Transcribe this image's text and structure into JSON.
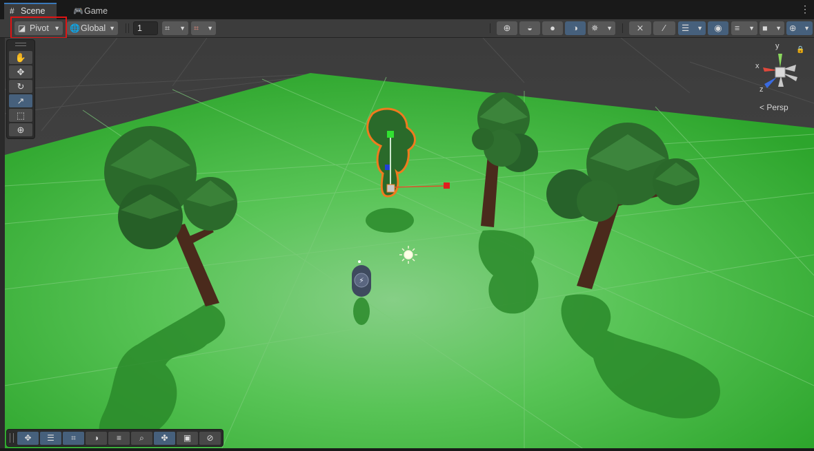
{
  "tabs": [
    {
      "label": "Scene",
      "icon": "grid-icon",
      "active": true
    },
    {
      "label": "Game",
      "icon": "gamepad-icon",
      "active": false
    }
  ],
  "toolbar": {
    "pivot_label": "Pivot",
    "global_label": "Global",
    "grid_value": "1"
  },
  "gizmo": {
    "x_label": "x",
    "y_label": "y",
    "z_label": "z",
    "persp_label": "< Persp"
  },
  "colors": {
    "accent": "#46607c",
    "highlight": "#e01414",
    "ground": "#4cc04c",
    "selection_outline": "#f07a1e"
  }
}
